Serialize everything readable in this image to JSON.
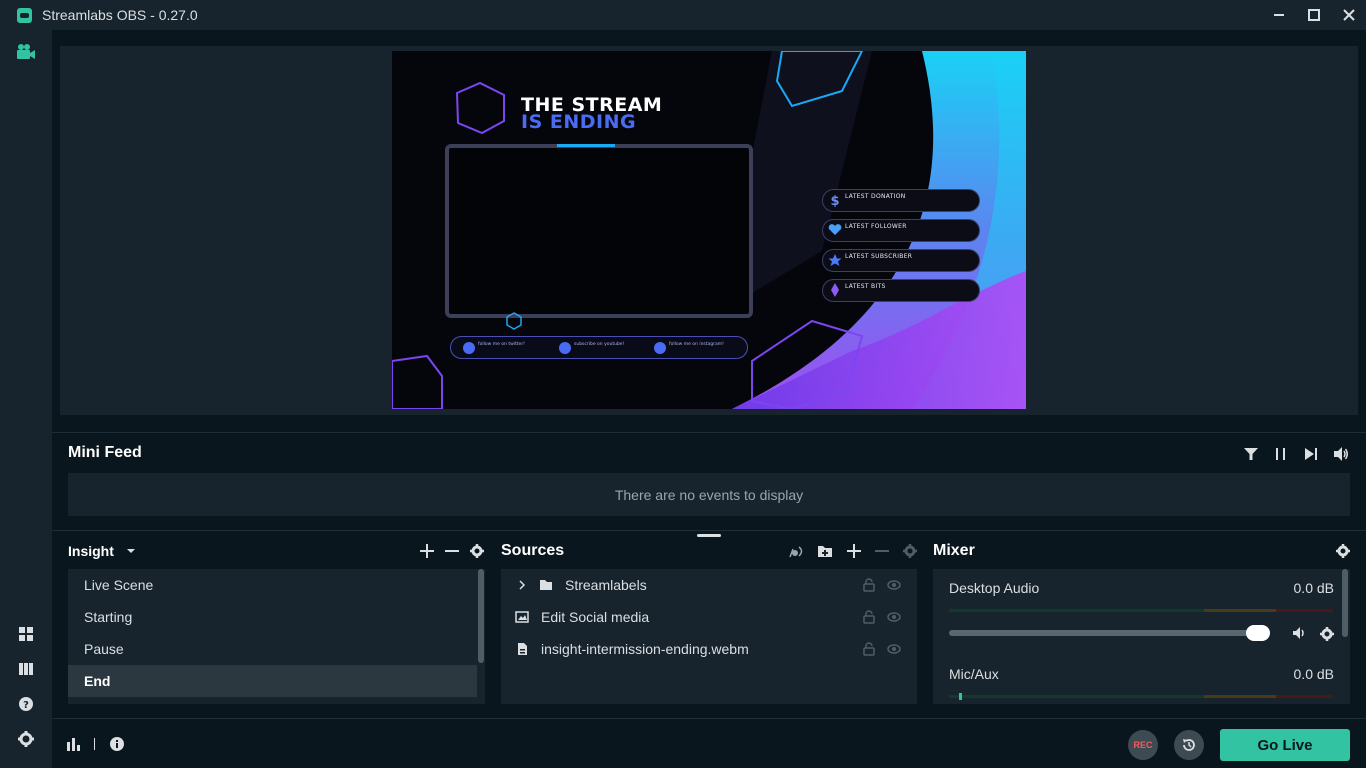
{
  "window": {
    "title": "Streamlabs OBS - 0.27.0",
    "controls": [
      "minimize-icon",
      "maximize-icon",
      "close-icon"
    ]
  },
  "sidebar": {
    "top_icon": "video-camera-icon",
    "bottom_icons": [
      "layout-icon",
      "studio-mode-icon",
      "help-icon",
      "settings-icon"
    ]
  },
  "preview": {
    "overlay": {
      "title_line1": "THE STREAM",
      "title_line2": "IS ENDING",
      "alerts": [
        {
          "label": "LATEST DONATION",
          "icon": "dollar-icon"
        },
        {
          "label": "LATEST FOLLOWER",
          "icon": "heart-icon"
        },
        {
          "label": "LATEST SUBSCRIBER",
          "icon": "star-icon"
        },
        {
          "label": "LATEST BITS",
          "icon": "diamond-icon"
        }
      ],
      "socials": [
        {
          "label": "follow me on twitter!",
          "icon": "twitter-icon"
        },
        {
          "label": "subscribe on youtube!",
          "icon": "youtube-icon"
        },
        {
          "label": "follow me on instagram!",
          "icon": "instagram-icon"
        }
      ]
    }
  },
  "mini_feed": {
    "title": "Mini Feed",
    "empty_text": "There are no events to display",
    "controls": [
      "filter-icon",
      "pause-icon",
      "skip-icon",
      "volume-icon"
    ]
  },
  "scenes": {
    "collection_name": "Insight",
    "items": [
      {
        "label": "Live Scene",
        "active": false
      },
      {
        "label": "Starting",
        "active": false
      },
      {
        "label": "Pause",
        "active": false
      },
      {
        "label": "End",
        "active": true
      }
    ]
  },
  "sources": {
    "title": "Sources",
    "items": [
      {
        "label": "Streamlabels",
        "icon": "folder-icon",
        "expandable": true
      },
      {
        "label": "Edit Social media",
        "icon": "image-icon",
        "expandable": false
      },
      {
        "label": "insight-intermission-ending.webm",
        "icon": "file-icon",
        "expandable": false
      }
    ]
  },
  "mixer": {
    "title": "Mixer",
    "channels": [
      {
        "name": "Desktop Audio",
        "db": "0.0 dB"
      },
      {
        "name": "Mic/Aux",
        "db": "0.0 dB"
      }
    ]
  },
  "footer": {
    "rec_label": "REC",
    "go_live_label": "Go Live"
  },
  "colors": {
    "accent": "#31c3a2",
    "panel": "#17242d",
    "background": "#09161d",
    "rec": "#f85961"
  }
}
